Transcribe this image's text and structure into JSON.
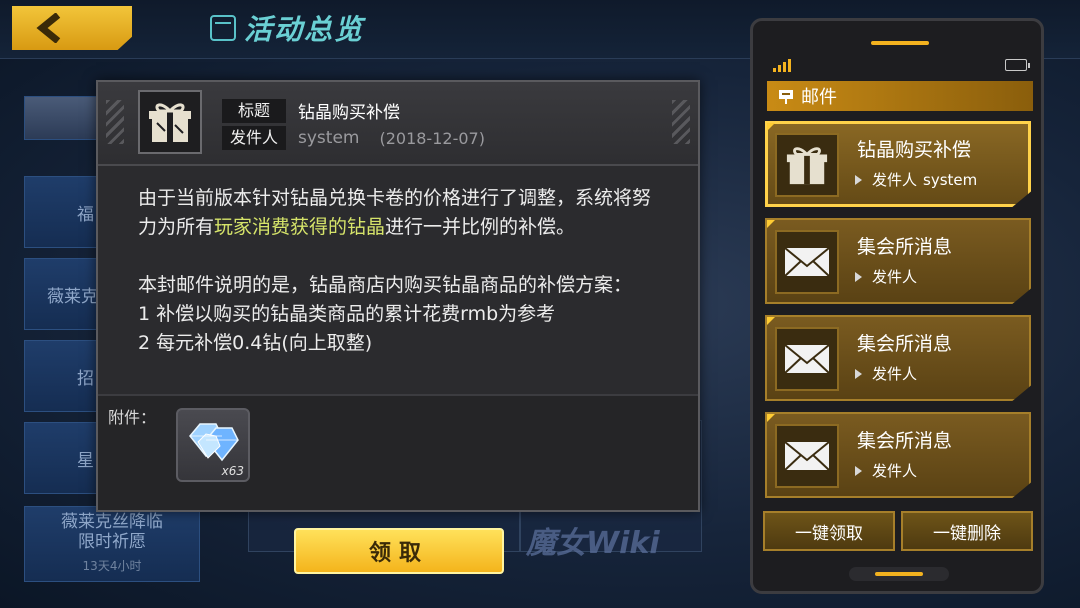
{
  "screen": {
    "title": "活动总览"
  },
  "background_list": [
    {
      "label": "福",
      "sub": ""
    },
    {
      "label": "薇莱克",
      "sub": ""
    },
    {
      "label": "招",
      "sub": ""
    },
    {
      "label": "星",
      "sub": ""
    },
    {
      "label": "薇莱克丝降临\n限时祈愿",
      "sub": "13天4小时"
    }
  ],
  "dialog": {
    "title_label": "标题",
    "title_value": "钻晶购买补偿",
    "sender_label": "发件人",
    "sender_value": "system",
    "date": "(2018-12-07)",
    "body_p1_pre": "由于当前版本针对钻晶兑换卡卷的价格进行了调整，系统将努力为所有",
    "body_p1_highlight": "玩家消费获得的钻晶",
    "body_p1_post": "进行一并比例的补偿。",
    "body_p2": "本封邮件说明的是，钻晶商店内购买钻晶商品的补偿方案：",
    "body_p3": "1 补偿以购买的钻晶类商品的累计花费rmb为参考",
    "body_p4": "2 每元补偿0.4钻(向上取整)",
    "attachment_label": "附件：",
    "attachment_count": "x63",
    "claim_button": "领取"
  },
  "mail_panel": {
    "header": "邮件",
    "items": [
      {
        "title": "钻晶购买补偿",
        "from_label": "发件人",
        "from_value": "system",
        "icon": "gift-icon"
      },
      {
        "title": "集会所消息",
        "from_label": "发件人",
        "from_value": "",
        "icon": "envelope-icon"
      },
      {
        "title": "集会所消息",
        "from_label": "发件人",
        "from_value": "",
        "icon": "envelope-icon"
      },
      {
        "title": "集会所消息",
        "from_label": "发件人",
        "from_value": "",
        "icon": "envelope-icon"
      }
    ],
    "claim_all": "一键领取",
    "delete_all": "一键删除"
  },
  "watermark": "魔女Wiki",
  "colors": {
    "accent": "#f3b21f",
    "highlight": "#d6e46a",
    "title": "#6ad0d4"
  }
}
